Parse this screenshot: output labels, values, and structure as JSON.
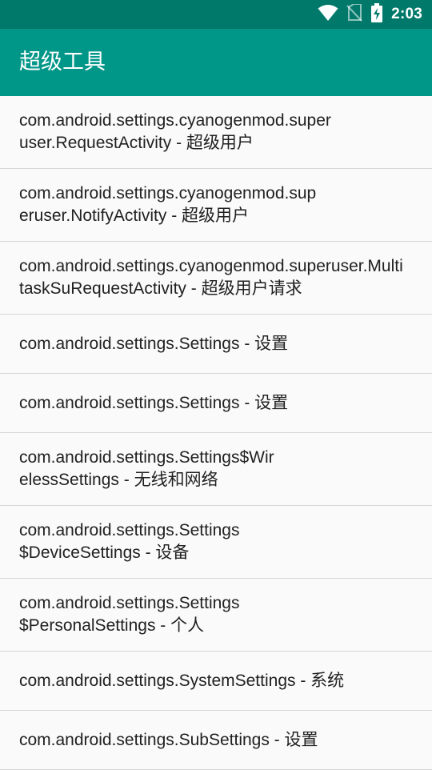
{
  "status_bar": {
    "time": "2:03",
    "icons": [
      "wifi-icon",
      "no-sim-icon",
      "battery-charging-icon"
    ]
  },
  "app_bar": {
    "title": "超级工具"
  },
  "activities": [
    {
      "text": "com.android.settings.cyanogenmod.superuser.RequestActivity - 超级用户"
    },
    {
      "text": "com.android.settings.cyanogenmod.superuser.NotifyActivity - 超级用户"
    },
    {
      "text": "com.android.settings.cyanogenmod.superuser.MultitaskSuRequestActivity - 超级用户请求"
    },
    {
      "text": "com.android.settings.Settings - 设置"
    },
    {
      "text": "com.android.settings.Settings - 设置"
    },
    {
      "text": "com.android.settings.Settings$WirelessSettings - 无线和网络"
    },
    {
      "text": "com.android.settings.Settings$DeviceSettings - 设备"
    },
    {
      "text": "com.android.settings.Settings$PersonalSettings - 个人"
    },
    {
      "text": "com.android.settings.SystemSettings - 系统"
    },
    {
      "text": "com.android.settings.SubSettings - 设置"
    }
  ]
}
